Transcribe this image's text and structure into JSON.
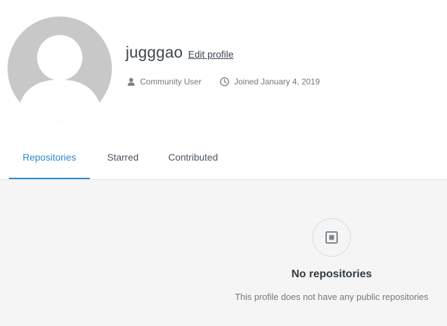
{
  "profile": {
    "username": "jugggao",
    "edit_label": "Edit profile",
    "role": "Community User",
    "joined": "Joined January 4, 2019"
  },
  "tabs": [
    {
      "label": "Repositories",
      "active": true
    },
    {
      "label": "Starred",
      "active": false
    },
    {
      "label": "Contributed",
      "active": false
    }
  ],
  "empty_state": {
    "icon": "repository-icon",
    "title": "No repositories",
    "description": "This profile does not have any public repositories"
  },
  "colors": {
    "accent": "#2b89c8",
    "text": "#3a4550",
    "muted": "#6f7880",
    "content_bg": "#f5f5f5",
    "avatar_bg": "#c8c8c8"
  }
}
